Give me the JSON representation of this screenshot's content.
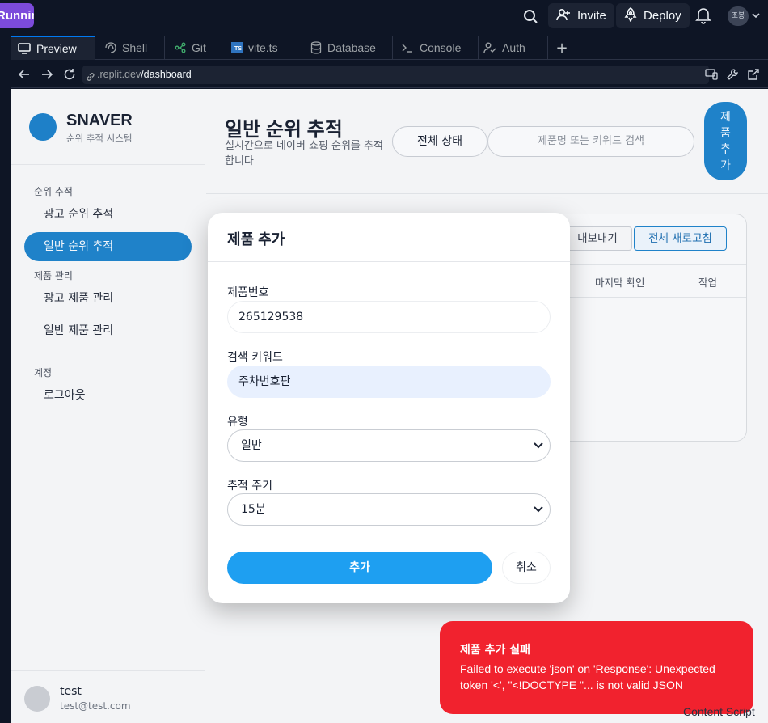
{
  "topbar": {
    "run_status": "Running",
    "invite_label": "Invite",
    "deploy_label": "Deploy",
    "avatar_initials": "조봉"
  },
  "tabs": [
    {
      "label": "Preview",
      "icon": "preview-icon",
      "active": true
    },
    {
      "label": "Shell",
      "icon": "shell-icon"
    },
    {
      "label": "Git",
      "icon": "git-icon"
    },
    {
      "label": "vite.ts",
      "icon": "typescript-file-icon"
    },
    {
      "label": "Database",
      "icon": "database-icon"
    },
    {
      "label": "Console",
      "icon": "console-icon"
    },
    {
      "label": "Auth",
      "icon": "auth-icon"
    }
  ],
  "url": {
    "host": ".replit.dev",
    "path": "/dashboard"
  },
  "sidebar": {
    "brand_name": "SNAVER",
    "brand_sub": "순위 추적 시스템",
    "section_rank": "순위 추적",
    "item_ad_rank": "광고 순위 추적",
    "item_general_rank": "일반 순위 추적",
    "section_product": "제품 관리",
    "item_ad_product": "광고 제품 관리",
    "item_general_product": "일반 제품 관리",
    "section_account": "계정",
    "item_logout": "로그아웃",
    "user_name": "test",
    "user_email": "test@test.com"
  },
  "main": {
    "title": "일반 순위 추적",
    "subtitle": "실시간으로 네이버 쇼핑 순위를 추적합니다",
    "status_filter": "전체 상태",
    "search_placeholder": "제품명 또는 키워드 검색",
    "add_product": "제품 추가",
    "export_label": "내보내기",
    "refresh_label": "전체 새로고침",
    "col_last_check": "마지막 확인",
    "col_action": "작업"
  },
  "modal": {
    "title": "제품 추가",
    "product_no_label": "제품번호",
    "product_no_value": "265129538",
    "keyword_label": "검색 키워드",
    "keyword_value": "주차번호판",
    "type_label": "유형",
    "type_value": "일반",
    "interval_label": "추적 주기",
    "interval_value": "15분",
    "add_button": "추가",
    "cancel_button": "취소"
  },
  "toast": {
    "title": "제품 추가 실패",
    "message": "Failed to execute 'json' on 'Response': Unexpected token '<', \"<!DOCTYPE \"... is not valid JSON"
  },
  "footer_overlay": "Content Script",
  "colors": {
    "accent": "#1f82c9",
    "primary_button": "#1e9ff1",
    "toast_bg": "#f1222e",
    "run_badge": "#7c4bdb"
  }
}
